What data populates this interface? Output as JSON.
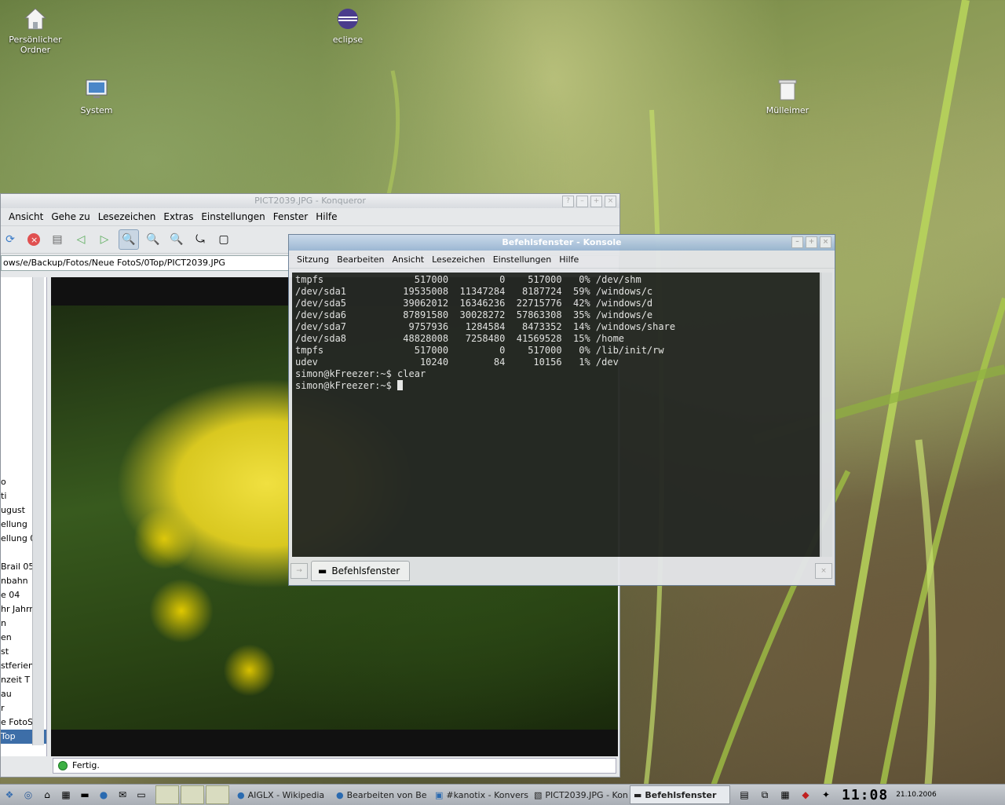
{
  "desktop": {
    "icons": [
      {
        "label": "Persönlicher\nOrdner",
        "icon": "home-folder-icon"
      },
      {
        "label": "eclipse",
        "icon": "eclipse-icon"
      },
      {
        "label": "System",
        "icon": "monitor-icon"
      },
      {
        "label": "Mülleimer",
        "icon": "trash-icon"
      }
    ]
  },
  "konqueror": {
    "title": "PICT2039.JPG - Konqueror",
    "menu": [
      "Ansicht",
      "Gehe zu",
      "Lesezeichen",
      "Extras",
      "Einstellungen",
      "Fenster",
      "Hilfe"
    ],
    "location": "ows/e/Backup/Fotos/Neue FotoS/0Top/PICT2039.JPG",
    "sidebar_items": [
      "o",
      "ti",
      "ugust",
      "ellung",
      "ellung 0",
      "",
      "Brail 05",
      "nbahn",
      "e 04",
      "hr Jahrr",
      "n",
      "en",
      "st",
      "stferien",
      "nzeit T u",
      "au",
      "r",
      "e FotoS",
      "Top"
    ],
    "status": "Fertig."
  },
  "konsole": {
    "title": "Befehlsfenster - Konsole",
    "menu": [
      "Sitzung",
      "Bearbeiten",
      "Ansicht",
      "Lesezeichen",
      "Einstellungen",
      "Hilfe"
    ],
    "lines": [
      "tmpfs                517000         0    517000   0% /dev/shm",
      "/dev/sda1          19535008  11347284   8187724  59% /windows/c",
      "/dev/sda5          39062012  16346236  22715776  42% /windows/d",
      "/dev/sda6          87891580  30028272  57863308  35% /windows/e",
      "/dev/sda7           9757936   1284584   8473352  14% /windows/share",
      "/dev/sda8          48828008   7258480  41569528  15% /home",
      "tmpfs                517000         0    517000   0% /lib/init/rw",
      "udev                  10240        84     10156   1% /dev",
      "simon@kFreezer:~$ clear",
      "simon@kFreezer:~$ "
    ],
    "tab_label": "Befehlsfenster"
  },
  "taskbar": {
    "tasks": [
      {
        "label": "AIGLX - Wikipedia",
        "active": false
      },
      {
        "label": "Bearbeiten von Be",
        "active": false
      },
      {
        "label": "#kanotix - Konvers",
        "active": false
      },
      {
        "label": "PICT2039.JPG - Kon",
        "active": false
      },
      {
        "label": "Befehlsfenster",
        "active": true
      }
    ],
    "clock": "11:08",
    "date": "21.10.2006"
  }
}
